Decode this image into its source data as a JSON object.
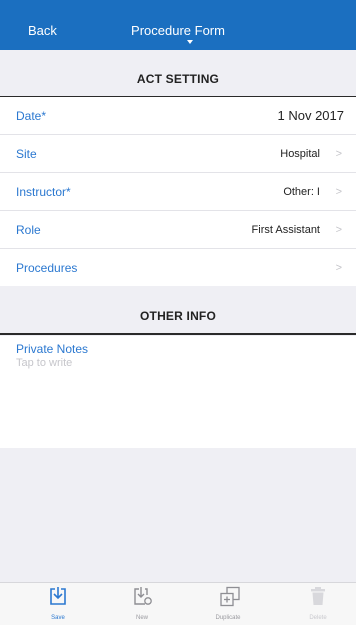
{
  "nav": {
    "back_label": "Back",
    "title": "Procedure Form"
  },
  "sections": {
    "act_setting": "ACT SETTING",
    "other_info": "OTHER INFO"
  },
  "fields": [
    {
      "label": "Date*",
      "value": "1 Nov 2017"
    },
    {
      "label": "Site",
      "value": "Hospital"
    },
    {
      "label": "Instructor*",
      "value": "Other: I"
    },
    {
      "label": "Role",
      "value": "First Assistant"
    },
    {
      "label": "Procedures",
      "value": ""
    }
  ],
  "notes": {
    "label": "Private Notes",
    "placeholder": "Tap to write"
  },
  "tabbar": {
    "save": "Save",
    "new": "New",
    "duplicate": "Duplicate",
    "delete": "Delete"
  },
  "colors": {
    "accent": "#1b6fc0",
    "link": "#2b78d0",
    "background": "#efeff4"
  }
}
